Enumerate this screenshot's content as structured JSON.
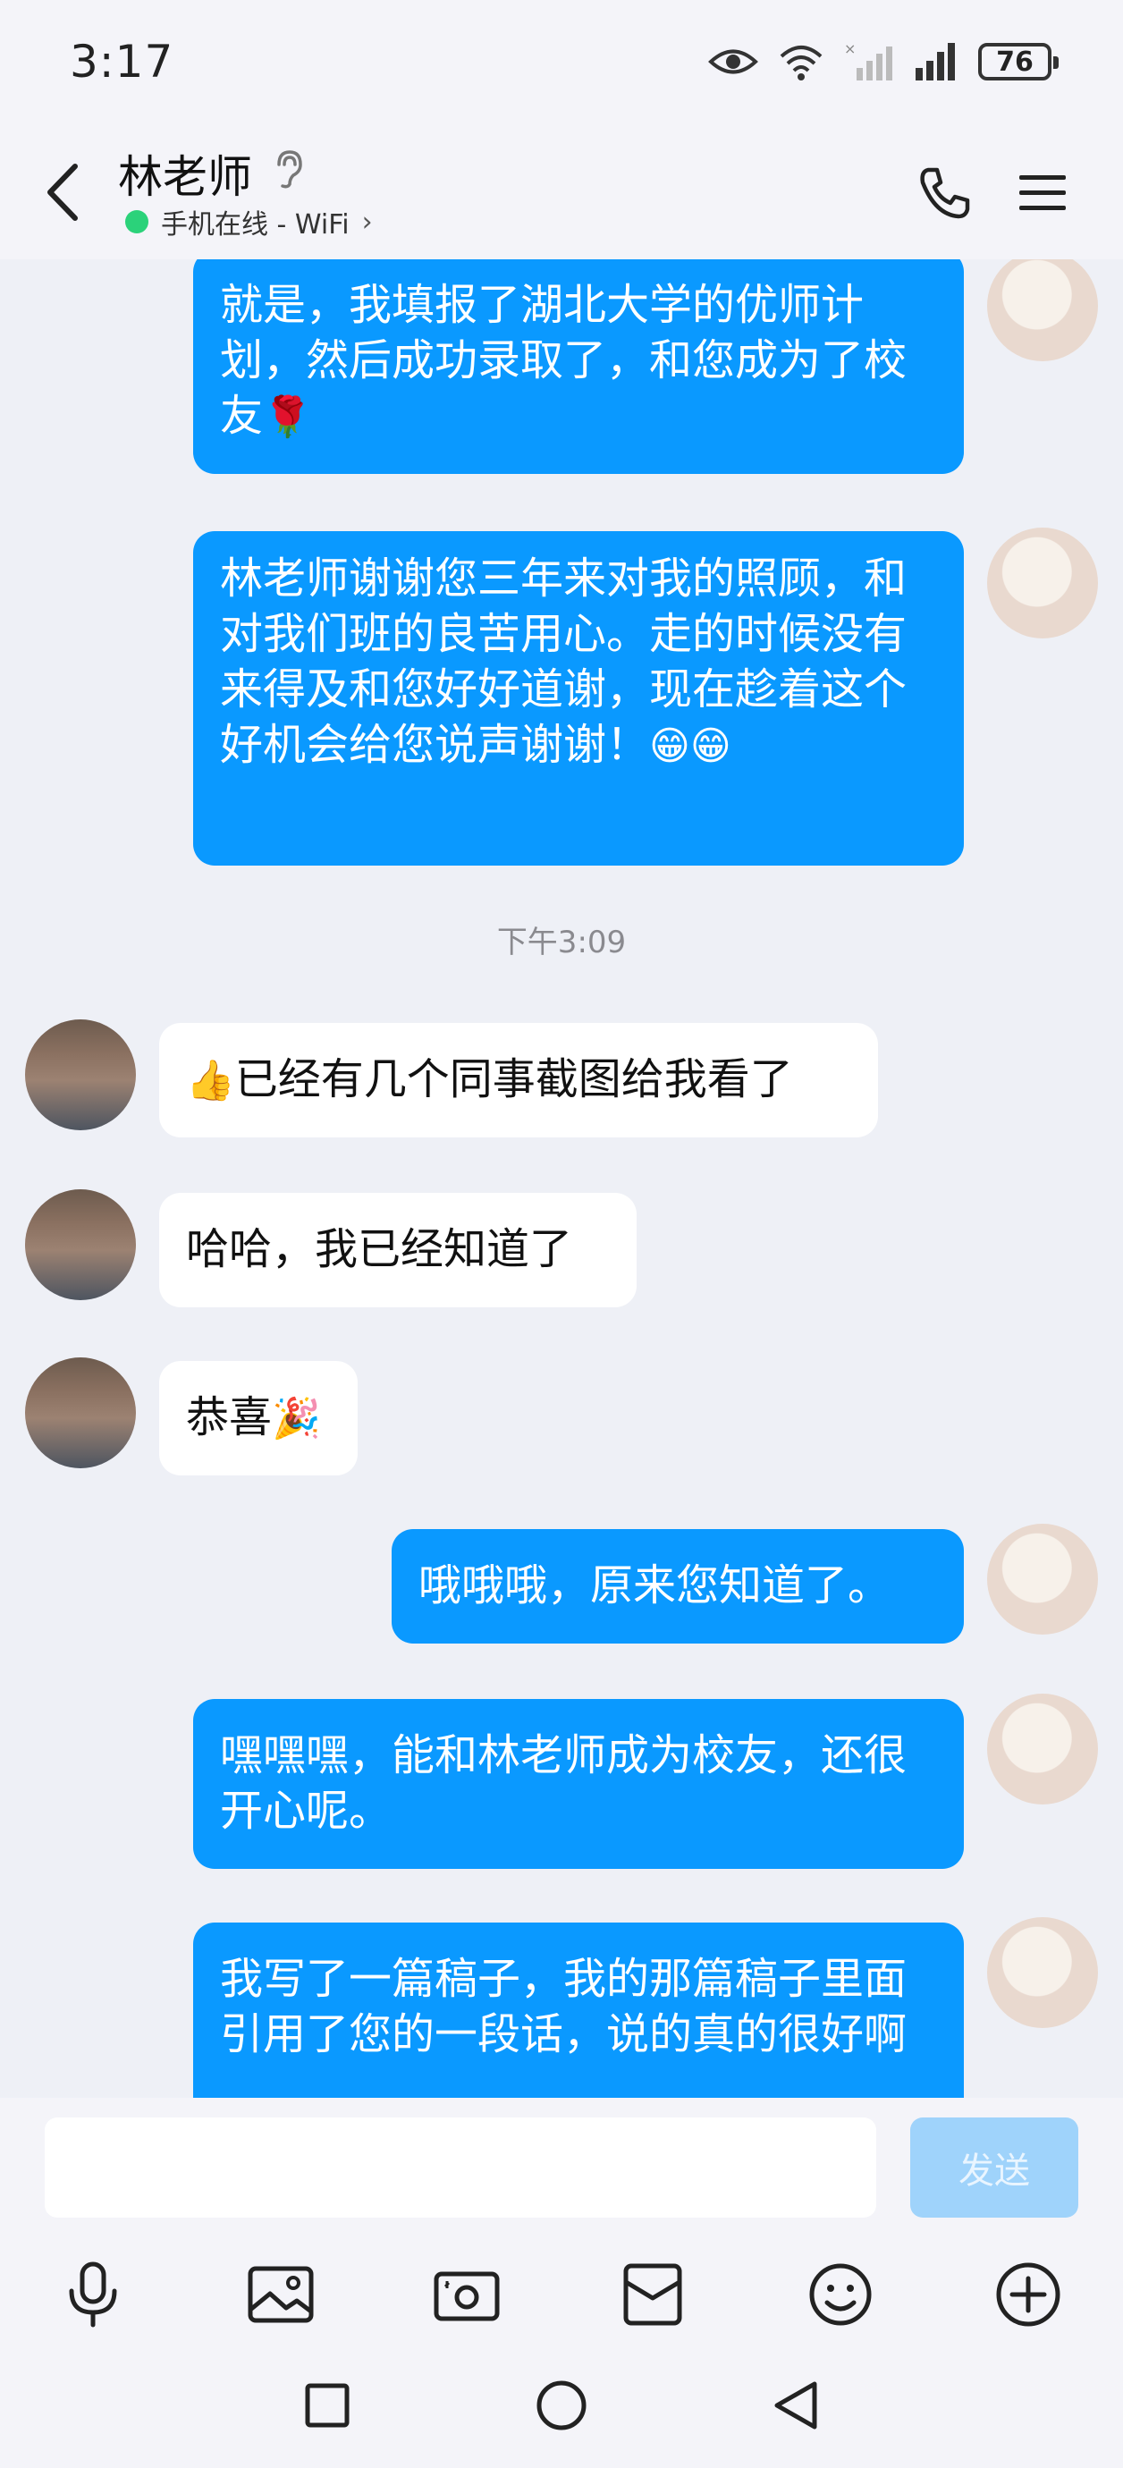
{
  "status_bar": {
    "time": "3:17",
    "battery": "76"
  },
  "header": {
    "contact_name": "林老师",
    "online_status": "手机在线 - WiFi",
    "online_chevron": "›"
  },
  "messages": [
    {
      "from": "me",
      "text": "就是，我填报了湖北大学的优师计划，然后成功录取了，和您成为了校友",
      "emoji": "🌹"
    },
    {
      "from": "me",
      "text": "林老师谢谢您三年来对我的照顾，和对我们班的良苦用心。走的时候没有来得及和您好好道谢，现在趁着这个好机会给您说声谢谢！",
      "emoji": "😁😁"
    },
    {
      "type": "time",
      "text": "下午3:09"
    },
    {
      "from": "them",
      "emoji": "👍",
      "text": "已经有几个同事截图给我看了"
    },
    {
      "from": "them",
      "text": "哈哈，我已经知道了"
    },
    {
      "from": "them",
      "text": "恭喜",
      "emoji": "🎉"
    },
    {
      "from": "me",
      "text": "哦哦哦，原来您知道了。"
    },
    {
      "from": "me",
      "text": "嘿嘿嘿，能和林老师成为校友，还很开心呢。"
    },
    {
      "from": "me",
      "text": "我写了一篇稿子，我的那篇稿子里面引用了您的一段话，说的真的很好啊"
    }
  ],
  "input": {
    "value": "",
    "placeholder": "",
    "send_label": "发送"
  },
  "toolbar_icons": [
    "microphone-icon",
    "image-icon",
    "camera-icon",
    "file-icon",
    "emoji-icon",
    "plus-icon"
  ],
  "colors": {
    "my_bubble": "#0a99ff",
    "their_bubble": "#ffffff",
    "background": "#eef0f6",
    "send_disabled": "#9fd3fb"
  }
}
